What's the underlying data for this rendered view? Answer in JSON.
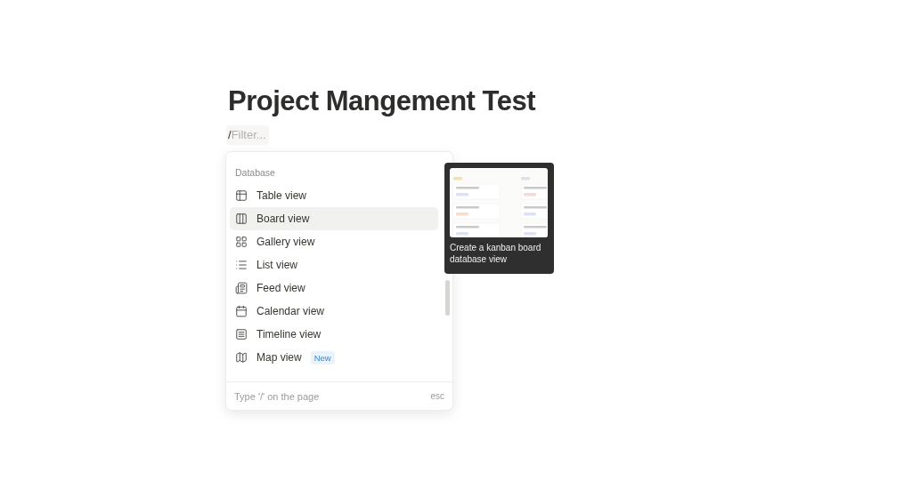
{
  "page": {
    "title": "Project Mangement Test"
  },
  "filter": {
    "prefix": "/",
    "placeholder": "Filter..."
  },
  "menu": {
    "section": "Database",
    "items": [
      {
        "label": "Table view",
        "selected": false
      },
      {
        "label": "Board view",
        "selected": true
      },
      {
        "label": "Gallery view",
        "selected": false
      },
      {
        "label": "List view",
        "selected": false
      },
      {
        "label": "Feed view",
        "selected": false
      },
      {
        "label": "Calendar view",
        "selected": false
      },
      {
        "label": "Timeline view",
        "selected": false
      },
      {
        "label": "Map view",
        "selected": false,
        "badge": "New"
      }
    ],
    "footer": {
      "hint": "Type '/' on the page",
      "shortcut": "esc"
    }
  },
  "tooltip": {
    "text": "Create a kanban board database view"
  }
}
